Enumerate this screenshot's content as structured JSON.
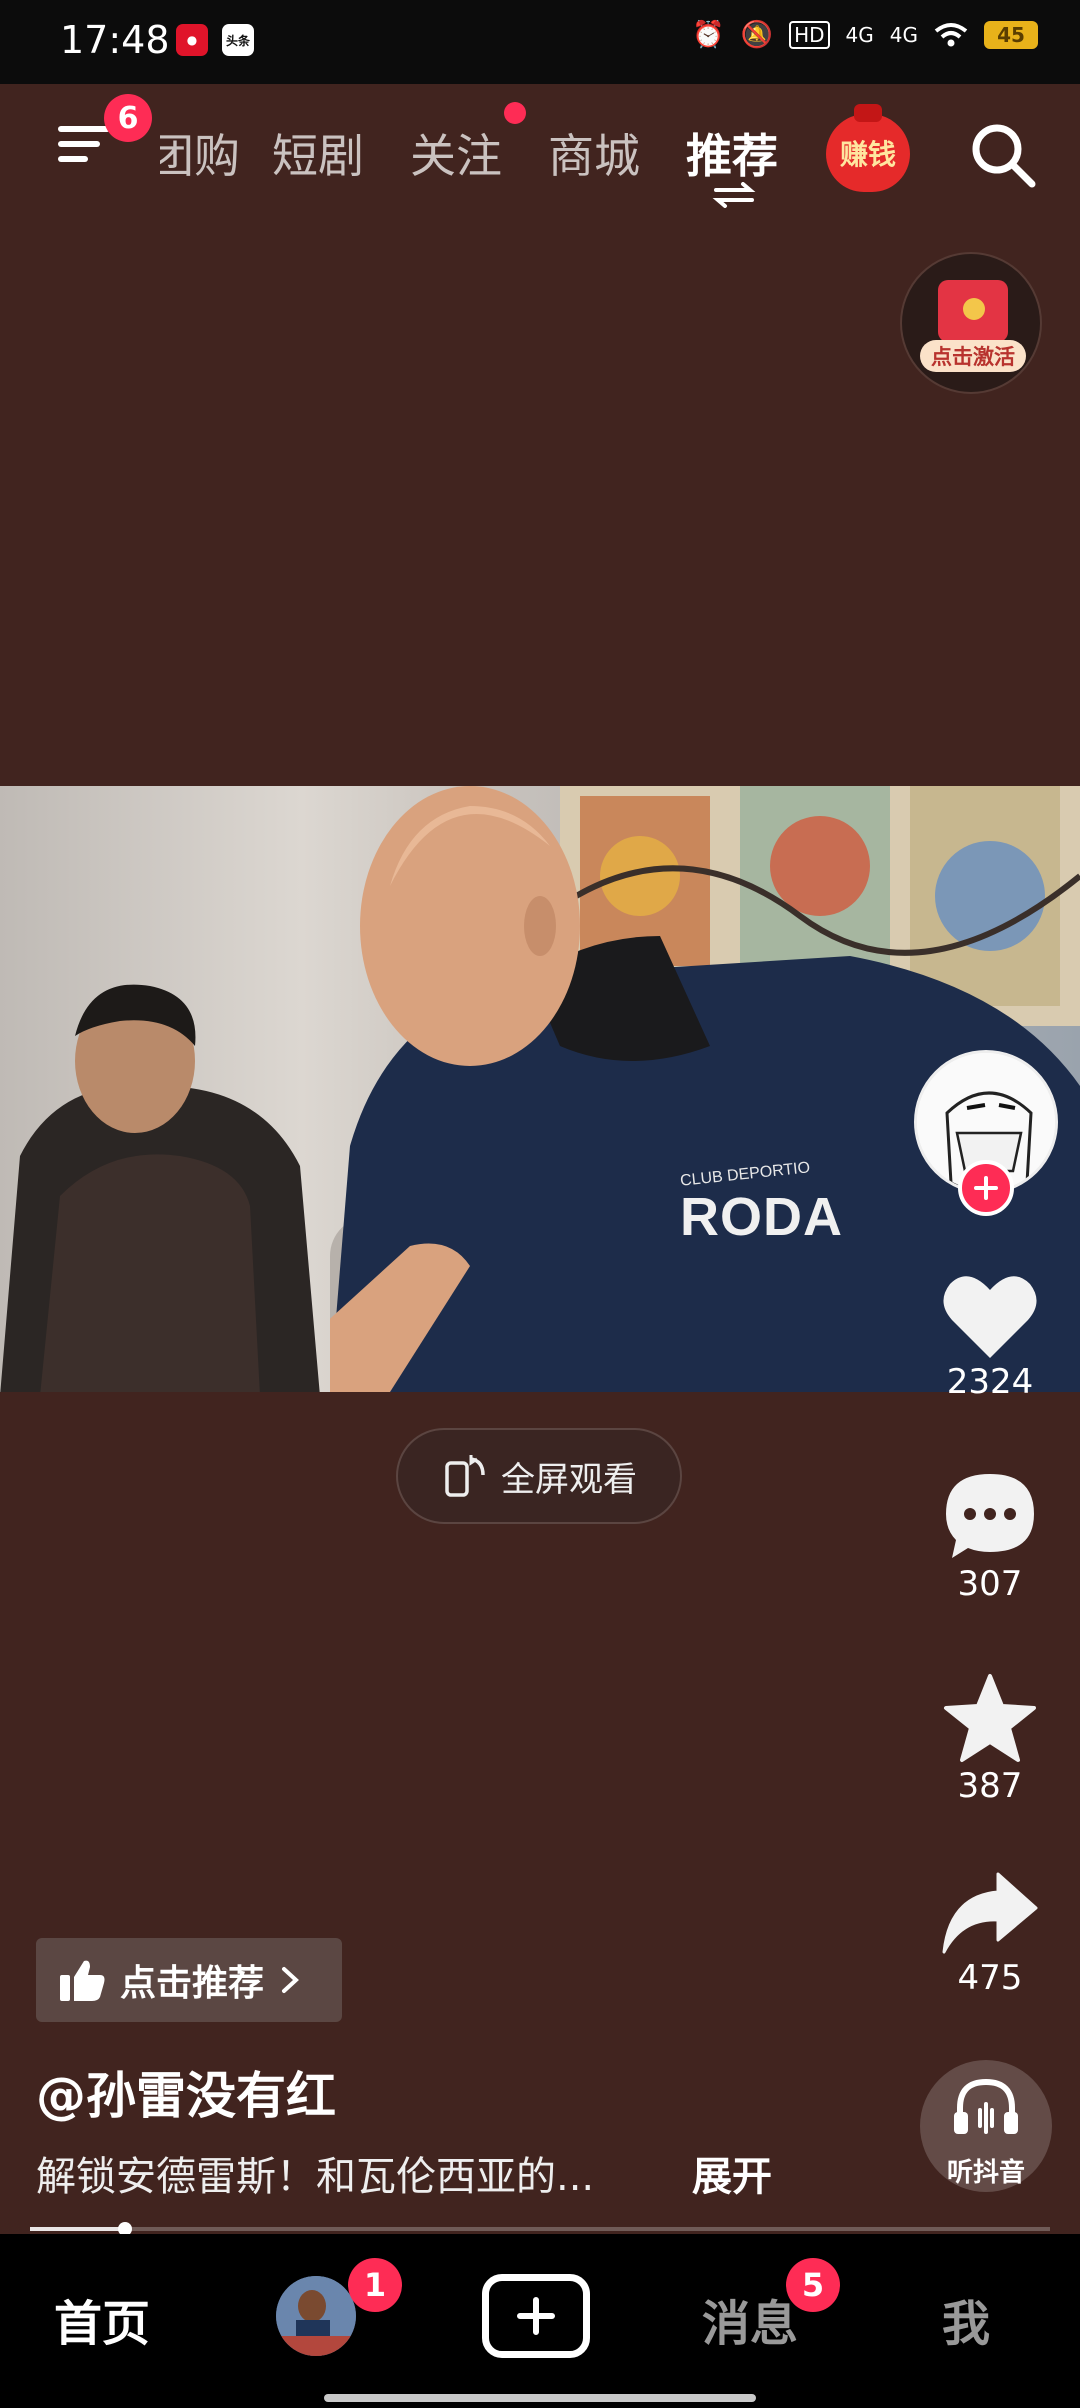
{
  "status_bar": {
    "time": "17:48",
    "app_icons": [
      "weibo-app-icon",
      "toutiao-app-icon"
    ],
    "toutiao_label": "头条",
    "network": "4G",
    "hd_label": "HD",
    "battery_level": "45"
  },
  "top_nav": {
    "menu_badge": "6",
    "tabs": [
      {
        "label": "团购",
        "active": false
      },
      {
        "label": "短剧",
        "active": false
      },
      {
        "label": "关注",
        "active": false,
        "dot": true
      },
      {
        "label": "商城",
        "active": false
      },
      {
        "label": "推荐",
        "active": true
      }
    ],
    "earn_label": "赚钱"
  },
  "activate": {
    "label": "点击激活"
  },
  "video": {
    "shirt_text": "RODA",
    "shirt_small_text": "CLUB DEPORTIO"
  },
  "fullscreen": {
    "label": "全屏观看"
  },
  "actions": {
    "likes": "2324",
    "comments": "307",
    "favorites": "387",
    "shares": "475"
  },
  "listen": {
    "label": "听抖音"
  },
  "caption": {
    "recommend_label": "点击推荐",
    "author": "@孙雷没有红",
    "description": "解锁安德雷斯！和瓦伦西亚的...",
    "expand_label": "展开"
  },
  "progress": {
    "fraction": 0.093
  },
  "bottom_nav": {
    "home": "首页",
    "friends_badge": "1",
    "messages": "消息",
    "messages_badge": "5",
    "me": "我"
  },
  "colors": {
    "background": "#41241f",
    "accent": "#fe2c55",
    "bottom_bar": "#000000"
  }
}
